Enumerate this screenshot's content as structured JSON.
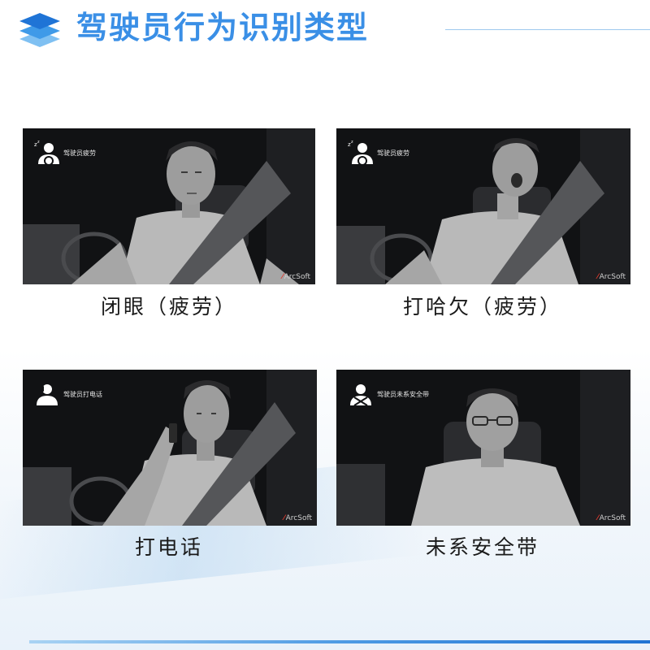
{
  "header": {
    "title": "驾驶员行为识别类型"
  },
  "panels": [
    {
      "badge": "驾驶员疲劳",
      "caption": "闭眼（疲劳）",
      "watermark": "ArcSoft"
    },
    {
      "badge": "驾驶员疲劳",
      "caption": "打哈欠（疲劳）",
      "watermark": "ArcSoft"
    },
    {
      "badge": "驾驶员打电话",
      "caption": "打电话",
      "watermark": "ArcSoft"
    },
    {
      "badge": "驾驶员未系安全带",
      "caption": "未系安全带",
      "watermark": "ArcSoft"
    }
  ],
  "colors": {
    "title": "#3a8fe6",
    "accent": "#1f73d3",
    "brand_mark": "#e03a2e"
  },
  "icons": [
    "stack-layers-icon",
    "driver-fatigue-icon",
    "driver-phone-icon",
    "driver-no-seatbelt-icon"
  ]
}
